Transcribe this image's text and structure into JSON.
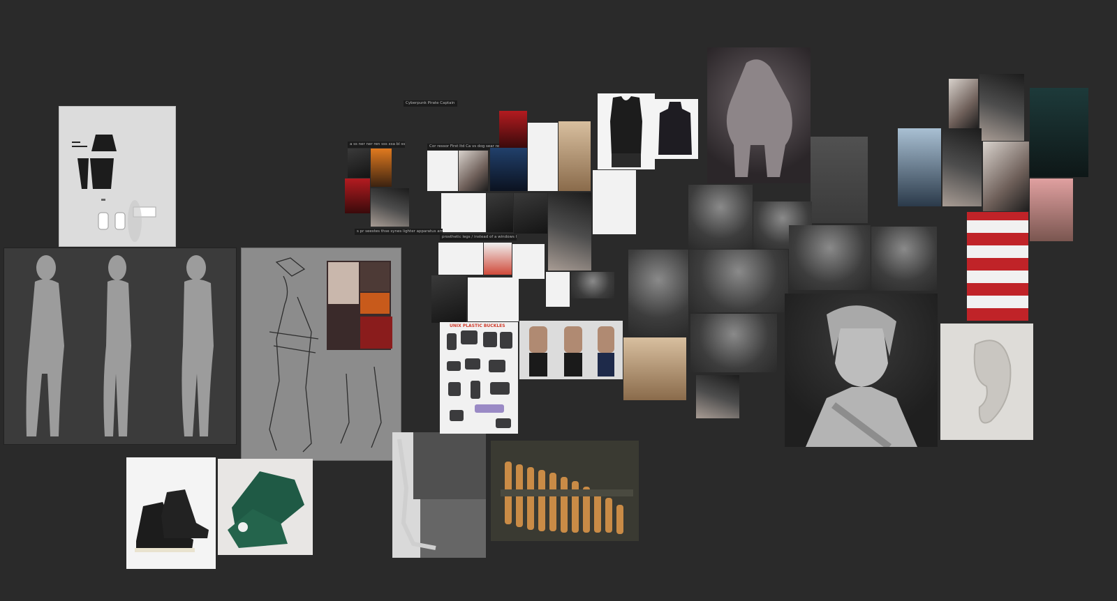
{
  "board": {
    "background": "#2a2a2a",
    "labels": {
      "title": "Cyberpunk Pirate Captain",
      "group_masks": "a ss ner ner ren sss xsa bl ssa se ss ll",
      "group_coats": "Cor ressor First ltd Ca vs dog sear ressr ld pant",
      "group_tech": "s pr seestes thse synes lighter apparatus armor smallsees",
      "group_prosthetic": "prosthetic legs / instead of a windows leg"
    },
    "images": [
      {
        "name": "clothing-pattern-sheet"
      },
      {
        "name": "anatomy-male-body-turnaround"
      },
      {
        "name": "character-concept-sketch-sheet"
      },
      {
        "name": "high-top-sneakers-black"
      },
      {
        "name": "high-top-sneakers-green"
      },
      {
        "name": "prosthetic-leg-photo"
      },
      {
        "name": "ammo-belt-photo"
      },
      {
        "name": "plastic-buckles-sheet",
        "caption": "UNIX PLASTIC BUCKLES"
      },
      {
        "name": "male-torso-references"
      },
      {
        "name": "armor-figurines"
      },
      {
        "name": "sleeveless-top-reference"
      },
      {
        "name": "turtleneck-reference"
      },
      {
        "name": "creature-sculpt-render"
      },
      {
        "name": "arm-anatomy-sculpt"
      },
      {
        "name": "head-stylized-sculpt"
      },
      {
        "name": "face-planes-reference"
      },
      {
        "name": "bald-head-sculpt"
      },
      {
        "name": "full-body-sculpt"
      },
      {
        "name": "torso-anatomy-sculpt"
      },
      {
        "name": "hair-sculpt-heads"
      },
      {
        "name": "portrait-photo"
      },
      {
        "name": "female-bust-sculpt"
      },
      {
        "name": "ear-sculpt"
      },
      {
        "name": "idol-photo-collage"
      },
      {
        "name": "stage-event-photo"
      }
    ]
  }
}
